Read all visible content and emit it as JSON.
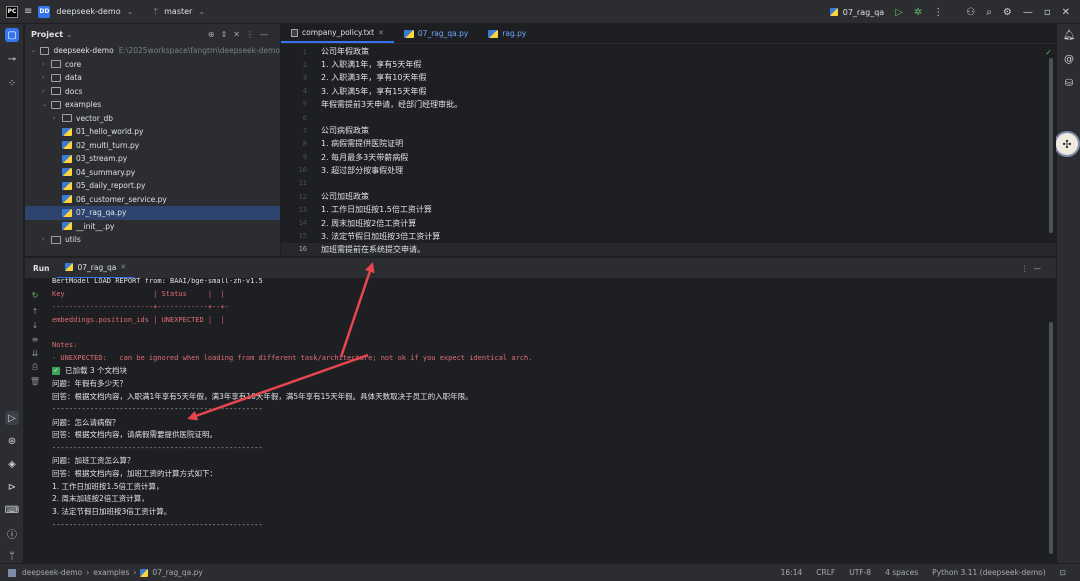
{
  "titlebar": {
    "app_badge": "PC",
    "project_badge": "DD",
    "project_name": "deepseek-demo",
    "branch": "master",
    "run_config": "07_rag_qa"
  },
  "project_panel": {
    "title": "Project",
    "tree": [
      {
        "indent": 0,
        "arrow": "v",
        "kind": "folder",
        "label": "deepseek-demo",
        "dim": "E:\\2025workspace\\fangtm\\deepseek-demo"
      },
      {
        "indent": 1,
        "arrow": ">",
        "kind": "folder",
        "label": "core",
        "dim": ""
      },
      {
        "indent": 1,
        "arrow": ">",
        "kind": "folder",
        "label": "data",
        "dim": ""
      },
      {
        "indent": 1,
        "arrow": ">",
        "kind": "folder",
        "label": "docs",
        "dim": ""
      },
      {
        "indent": 1,
        "arrow": "v",
        "kind": "folder",
        "label": "examples",
        "dim": ""
      },
      {
        "indent": 2,
        "arrow": ">",
        "kind": "folder",
        "label": "vector_db",
        "dim": ""
      },
      {
        "indent": 2,
        "arrow": "",
        "kind": "py",
        "label": "01_hello_world.py",
        "dim": ""
      },
      {
        "indent": 2,
        "arrow": "",
        "kind": "py",
        "label": "02_multi_turn.py",
        "dim": ""
      },
      {
        "indent": 2,
        "arrow": "",
        "kind": "py",
        "label": "03_stream.py",
        "dim": ""
      },
      {
        "indent": 2,
        "arrow": "",
        "kind": "py",
        "label": "04_summary.py",
        "dim": ""
      },
      {
        "indent": 2,
        "arrow": "",
        "kind": "py",
        "label": "05_daily_report.py",
        "dim": ""
      },
      {
        "indent": 2,
        "arrow": "",
        "kind": "py",
        "label": "06_customer_service.py",
        "dim": ""
      },
      {
        "indent": 2,
        "arrow": "",
        "kind": "py",
        "label": "07_rag_qa.py",
        "dim": "",
        "selected": true
      },
      {
        "indent": 2,
        "arrow": "",
        "kind": "py",
        "label": "__init__.py",
        "dim": ""
      },
      {
        "indent": 1,
        "arrow": ">",
        "kind": "folder",
        "label": "utils",
        "dim": ""
      }
    ]
  },
  "editor": {
    "tabs": [
      {
        "label": "company_policy.txt",
        "kind": "txt",
        "active": true
      },
      {
        "label": "07_rag_qa.py",
        "kind": "py",
        "active": false
      },
      {
        "label": "rag.py",
        "kind": "py",
        "active": false
      }
    ],
    "lines": [
      {
        "n": "1",
        "text": "公司年假政策"
      },
      {
        "n": "2",
        "text": "1. 入职满1年，享有5天年假"
      },
      {
        "n": "3",
        "text": "2. 入职满3年，享有10天年假"
      },
      {
        "n": "4",
        "text": "3. 入职满5年，享有15天年假"
      },
      {
        "n": "5",
        "text": "年假需提前3天申请，经部门经理审批。"
      },
      {
        "n": "6",
        "text": ""
      },
      {
        "n": "7",
        "text": "公司病假政策"
      },
      {
        "n": "8",
        "text": "1. 病假需提供医院证明"
      },
      {
        "n": "9",
        "text": "2. 每月最多3天带薪病假"
      },
      {
        "n": "10",
        "text": "3. 超过部分按事假处理"
      },
      {
        "n": "11",
        "text": ""
      },
      {
        "n": "12",
        "text": "公司加班政策"
      },
      {
        "n": "13",
        "text": "1. 工作日加班按1.5倍工资计算"
      },
      {
        "n": "14",
        "text": "2. 周末加班按2倍工资计算"
      },
      {
        "n": "15",
        "text": "3. 法定节假日加班按3倍工资计算"
      },
      {
        "n": "16",
        "text": "加班需提前在系统提交申请。",
        "current": true
      }
    ]
  },
  "run": {
    "label": "Run",
    "tab": "07_rag_qa",
    "console": [
      {
        "style": "mono",
        "text": "BertModel LOAD REPORT from: BAAI/bge-small-zh-v1.5"
      },
      {
        "style": "mono red",
        "text": "Key                     | Status     |  |"
      },
      {
        "style": "mono red",
        "text": "------------------------+------------+--+-"
      },
      {
        "style": "mono red",
        "text": "embeddings.position_ids | UNEXPECTED |  |"
      },
      {
        "style": "mono",
        "text": ""
      },
      {
        "style": "mono red",
        "text": "Notes:"
      },
      {
        "style": "mono red",
        "text": "- UNEXPECTED:   can be ignored when loading from different task/architecture; not ok if you expect identical arch."
      },
      {
        "style": "check",
        "text": "已加载 3 个文档块"
      },
      {
        "style": "",
        "text": "问题：年假有多少天？"
      },
      {
        "style": "",
        "text": "回答：根据文档内容，入职满1年享有5天年假，满3年享有10天年假，满5年享有15天年假。具体天数取决于员工的入职年限。"
      },
      {
        "style": "mono sep",
        "text": "--------------------------------------------------"
      },
      {
        "style": "",
        "text": "问题：怎么请病假？"
      },
      {
        "style": "",
        "text": "回答：根据文档内容，请病假需要提供医院证明。"
      },
      {
        "style": "mono sep",
        "text": "--------------------------------------------------"
      },
      {
        "style": "",
        "text": "问题：加班工资怎么算？"
      },
      {
        "style": "",
        "text": "回答：根据文档内容，加班工资的计算方式如下："
      },
      {
        "style": "",
        "text": "1. 工作日加班按1.5倍工资计算，"
      },
      {
        "style": "",
        "text": "2. 周末加班按2倍工资计算，"
      },
      {
        "style": "",
        "text": "3. 法定节假日加班按3倍工资计算。"
      },
      {
        "style": "mono sep",
        "text": "--------------------------------------------------"
      }
    ]
  },
  "statusbar": {
    "breadcrumb": [
      "deepseek-demo",
      "examples",
      "07_rag_qa.py"
    ],
    "position": "16:14",
    "line_sep": "CRLF",
    "encoding": "UTF-8",
    "indent": "4 spaces",
    "interpreter": "Python 3.11 (deepseek-demo)"
  },
  "colors": {
    "accent": "#3574f0",
    "arrow": "#e8454f",
    "error_text": "#e06c75"
  }
}
